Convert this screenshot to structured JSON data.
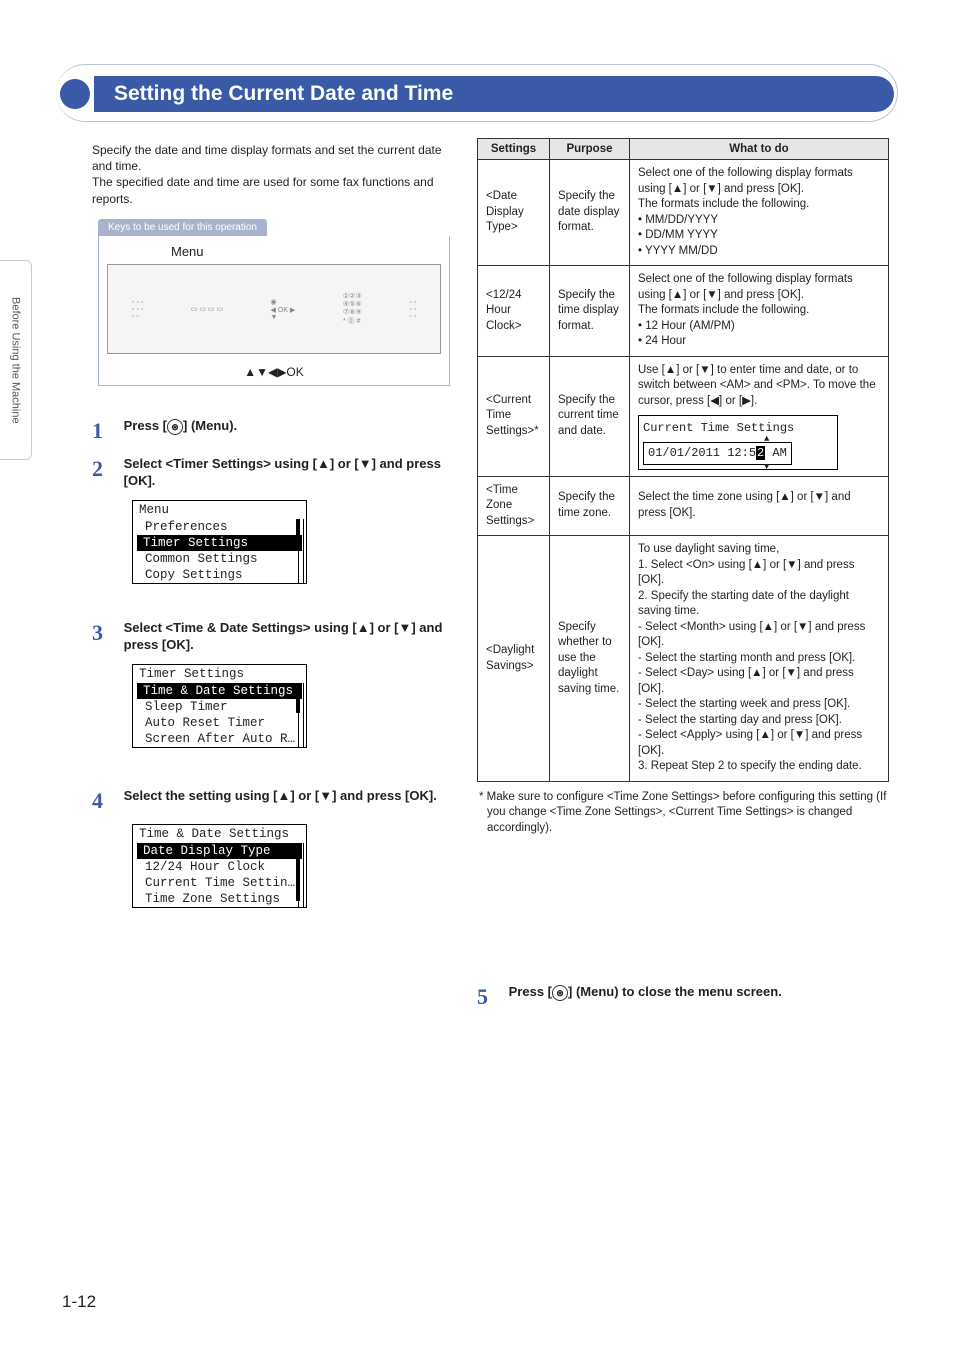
{
  "sideTab": "Before Using the Machine",
  "title": "Setting the Current Date and Time",
  "intro": "Specify the date and time display formats and set the current date and time.\nThe specified date and time are used for some fax functions and reports.",
  "keysHeader": "Keys to be used for this operation",
  "menuLabel": "Menu",
  "panelOk": "▲▼◀▶OK",
  "steps": {
    "s1": {
      "num": "1",
      "text": "Press [    ] (Menu)."
    },
    "s2": {
      "num": "2",
      "text": "Select <Timer Settings> using [▲] or [▼] and press [OK]."
    },
    "s3": {
      "num": "3",
      "text": "Select <Time & Date Settings> using [▲] or [▼] and press [OK]."
    },
    "s4": {
      "num": "4",
      "text": "Select the setting using [▲] or [▼] and press [OK]."
    },
    "s5": {
      "num": "5",
      "text": "Press [     ] (Menu) to close the menu screen."
    }
  },
  "lcd1": {
    "title": "Menu",
    "rows": [
      "Preferences",
      "Timer Settings",
      "Common Settings",
      "Copy Settings"
    ],
    "selected": 1
  },
  "lcd2": {
    "title": "Timer Settings",
    "rows": [
      "Time & Date Settings",
      "Sleep Timer",
      "Auto Reset Timer",
      "Screen After Auto R…"
    ],
    "selected": 0
  },
  "lcd3": {
    "title": "Time & Date Settings",
    "rows": [
      "Date Display Type",
      "12/24 Hour Clock",
      "Current Time Settin…",
      "Time Zone Settings"
    ],
    "selected": 0
  },
  "table": {
    "headers": [
      "Settings",
      "Purpose",
      "What to do"
    ],
    "rows": [
      {
        "s": "<Date Display Type>",
        "p": "Specify the date display format.",
        "w": "Select one of the following display formats using [▲] or [▼] and press [OK].\nThe formats include the following.\n• MM/DD/YYYY\n• DD/MM YYYY\n• YYYY MM/DD"
      },
      {
        "s": "<12/24 Hour Clock>",
        "p": "Specify the time display format.",
        "w": "Select one of the following display formats using [▲] or [▼] and press [OK].\nThe formats include the following.\n• 12 Hour (AM/PM)\n• 24 Hour"
      },
      {
        "s": "<Current Time Settings>*",
        "p": "Specify the current time and date.",
        "w": "Use [▲] or [▼] to enter time and date, or to switch between <AM> and <PM>. To move the cursor, press [◀] or [▶].",
        "lcdTitle": "Current Time Settings",
        "lcdDate": "01/01/2011 12:5",
        "lcdCursor": "2",
        "lcdSuffix": " AM"
      },
      {
        "s": "<Time Zone Settings>",
        "p": "Specify the time zone.",
        "w": "Select the time zone using [▲] or [▼] and press [OK]."
      },
      {
        "s": "<Daylight Savings>",
        "p": "Specify whether to use the daylight saving time.",
        "w": "To use daylight saving time,\n1. Select <On> using [▲] or [▼] and press [OK].\n2. Specify the starting date of the daylight saving time.\n - Select <Month> using [▲] or [▼] and press [OK].\n - Select the starting month and press [OK].\n - Select <Day> using [▲] or [▼] and press [OK].\n - Select the starting week and press [OK].\n - Select the starting day and press [OK].\n - Select <Apply> using [▲] or [▼] and press [OK].\n3. Repeat Step 2 to specify the ending date."
      }
    ]
  },
  "footnote": "* Make sure to configure <Time Zone Settings> before configuring this setting (If you change <Time Zone Settings>, <Current Time Settings> is changed accordingly).",
  "pageNum": "1-12"
}
